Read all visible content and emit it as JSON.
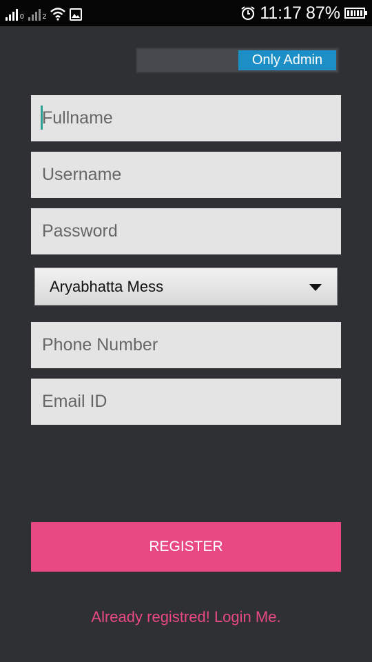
{
  "status_bar": {
    "sim1_mark": "0",
    "sim2_mark": "2",
    "time": "11:17",
    "battery_percent": "87%",
    "icons": [
      "signal-icon",
      "signal-icon",
      "wifi-icon",
      "image-icon",
      "alarm-icon",
      "battery-icon"
    ]
  },
  "toggle": {
    "label": "Only Admin",
    "state": "on",
    "accent_color": "#1c8fc6"
  },
  "form": {
    "fullname_placeholder": "Fullname",
    "username_placeholder": "Username",
    "password_placeholder": "Password",
    "mess_selected": "Aryabhatta Mess",
    "phone_placeholder": "Phone Number",
    "email_placeholder": "Email ID"
  },
  "actions": {
    "register_label": "REGISTER",
    "login_link": "Already registred! Login Me.",
    "accent_color": "#e94983"
  }
}
